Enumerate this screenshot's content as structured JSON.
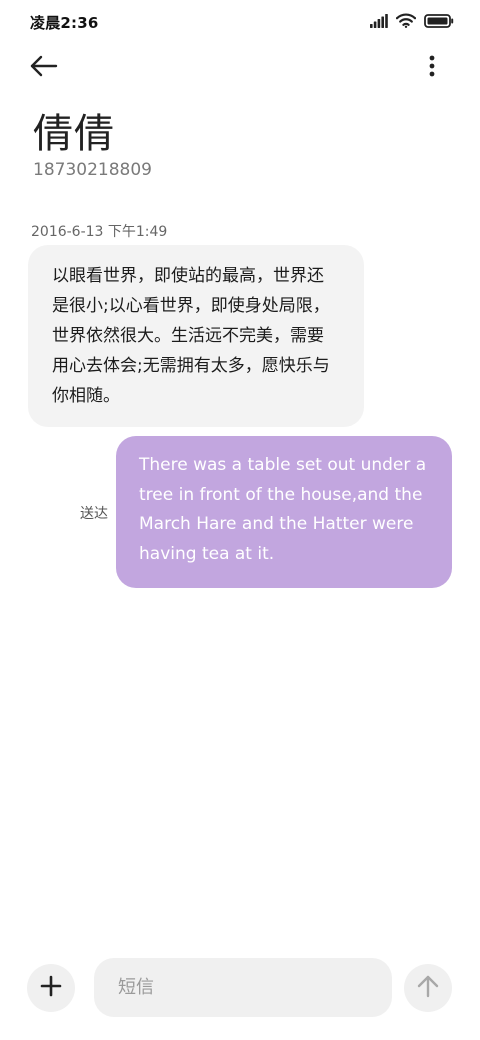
{
  "status_bar": {
    "time": "凌晨2:36",
    "icons": [
      "signal-icon",
      "wifi-icon",
      "battery-icon"
    ]
  },
  "header": {
    "back_icon": "arrow-left-icon",
    "more_icon": "more-vertical-icon"
  },
  "contact": {
    "name": "倩倩",
    "number": "18730218809"
  },
  "conversation": {
    "timestamp": "2016-6-13 下午1:49",
    "incoming": {
      "text": "以眼看世界，即使站的最高，世界还是很小;以心看世界，即使身处局限，世界依然很大。生活远不完美，需要用心去体会;无需拥有太多，愿快乐与你相随。"
    },
    "outgoing": {
      "text": "There was a table set out under a tree in front of the house,and the March Hare and the Hatter were having tea at it.",
      "status": "送达"
    }
  },
  "composer": {
    "placeholder": "短信",
    "value": "",
    "add_icon": "plus-icon",
    "send_icon": "arrow-up-icon"
  },
  "colors": {
    "outgoing_bubble": "#c2a6df",
    "incoming_bubble": "#f3f3f3",
    "composer_bg": "#f0f0f0"
  }
}
